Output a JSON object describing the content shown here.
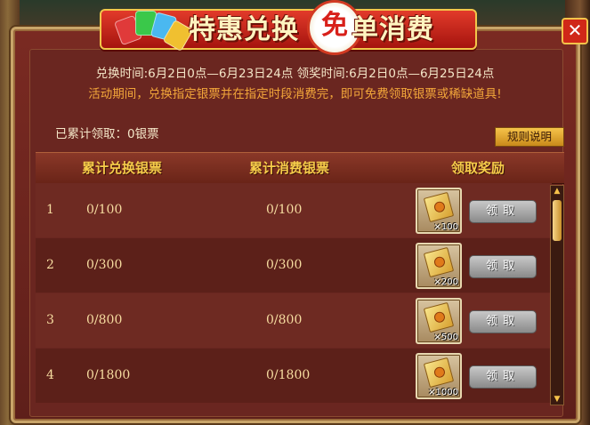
{
  "window": {
    "title_left": "特惠兑换",
    "title_badge": "免",
    "title_right": "单消费",
    "close_glyph": "✕"
  },
  "info": {
    "line1": "兑换时间:6月2日0点—6月23日24点   领奖时间:6月2日0点—6月25日24点",
    "line2": "活动期间，兑换指定银票并在指定时段消费完，即可免费领取银票或稀缺道具!"
  },
  "accumulated": "已累计领取：0银票",
  "rules_button": "规则说明",
  "table": {
    "headers": [
      "累计兑换银票",
      "累计消费银票",
      "领取奖励"
    ],
    "rows": [
      {
        "index": "1",
        "exchanged": "0/100",
        "consumed": "0/100",
        "reward_count": "×100",
        "claim": "领取"
      },
      {
        "index": "2",
        "exchanged": "0/300",
        "consumed": "0/300",
        "reward_count": "×200",
        "claim": "领取"
      },
      {
        "index": "3",
        "exchanged": "0/800",
        "consumed": "0/800",
        "reward_count": "×500",
        "claim": "领取"
      },
      {
        "index": "4",
        "exchanged": "0/1800",
        "consumed": "0/1800",
        "reward_count": "×1000",
        "claim": "领取"
      }
    ]
  },
  "icons": {
    "reward": "silver-ticket-icon",
    "scroll_up": "▲",
    "scroll_down": "▼"
  },
  "colors": {
    "panel": "#6a2620",
    "header_text": "#f6cc4a",
    "notice_text": "#f2a63a",
    "banner_red": "#d8201a"
  }
}
